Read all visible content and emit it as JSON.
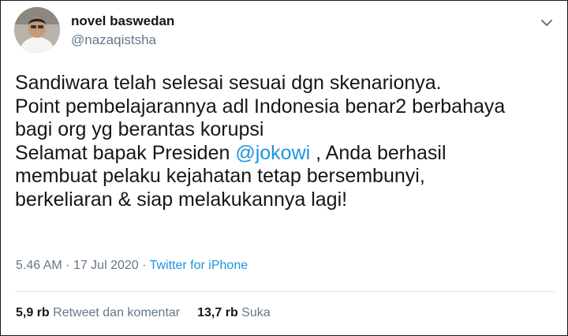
{
  "user": {
    "name": "novel baswedan",
    "handle": "@nazaqistsha"
  },
  "tweet": {
    "line1": "Sandiwara telah selesai sesuai dgn skenarionya.",
    "line2": "Point pembelajarannya adl Indonesia benar2 berbahaya",
    "line3": "bagi org yg berantas korupsi",
    "line4_before": "Selamat bapak Presiden ",
    "mention": "@jokowi",
    "line4_after": " , Anda berhasil",
    "line5": "membuat pelaku kejahatan tetap bersembunyi,",
    "line6": "berkeliaran & siap melakukannya lagi!"
  },
  "meta": {
    "time": "5.46 AM",
    "separator": "·",
    "date": "17 Jul 2020",
    "source": "Twitter for iPhone"
  },
  "stats": {
    "retweets_count": "5,9 rb",
    "retweets_label": "Retweet dan komentar",
    "likes_count": "13,7 rb",
    "likes_label": "Suka"
  },
  "colors": {
    "link": "#1b95e0",
    "secondary_text": "#657786",
    "primary_text": "#14171a"
  },
  "icons": {
    "menu": "chevron-down-icon"
  }
}
